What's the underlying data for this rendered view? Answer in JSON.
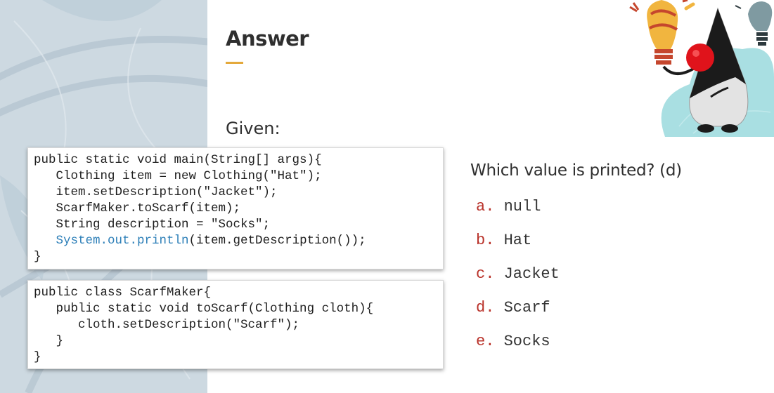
{
  "slide": {
    "title": "Answer",
    "given_label": "Given:",
    "question": "Which value is printed? (d)"
  },
  "code_main": {
    "lines": [
      "public static void main(String[] args){",
      "   Clothing item = new Clothing(\"Hat\");",
      "   item.setDescription(\"Jacket\");",
      "   ScarfMaker.toScarf(item);",
      "   String description = \"Socks\";",
      "(item.getDescription());",
      "}"
    ],
    "highlight_prefix": "   ",
    "highlight_text": "System.out.println"
  },
  "code_scarf": {
    "lines": [
      "public class ScarfMaker{",
      "   public static void toScarf(Clothing cloth){",
      "      cloth.setDescription(\"Scarf\");",
      "   }",
      "}"
    ]
  },
  "options": [
    {
      "letter": "a.",
      "value": "null"
    },
    {
      "letter": "b.",
      "value": "Hat"
    },
    {
      "letter": "c.",
      "value": "Jacket"
    },
    {
      "letter": "d.",
      "value": "Scarf"
    },
    {
      "letter": "e.",
      "value": "Socks"
    }
  ],
  "colors": {
    "accent_underline": "#e4a93c",
    "option_letter": "#b9322a",
    "code_link": "#2d7fb8",
    "left_panel": "#cdd9e1",
    "mascot_backdrop": "#a9dfe2"
  },
  "icons": {
    "mascot": "duke-mascot-with-lightbulb-icon",
    "decor": "leaf-pattern-decoration"
  }
}
